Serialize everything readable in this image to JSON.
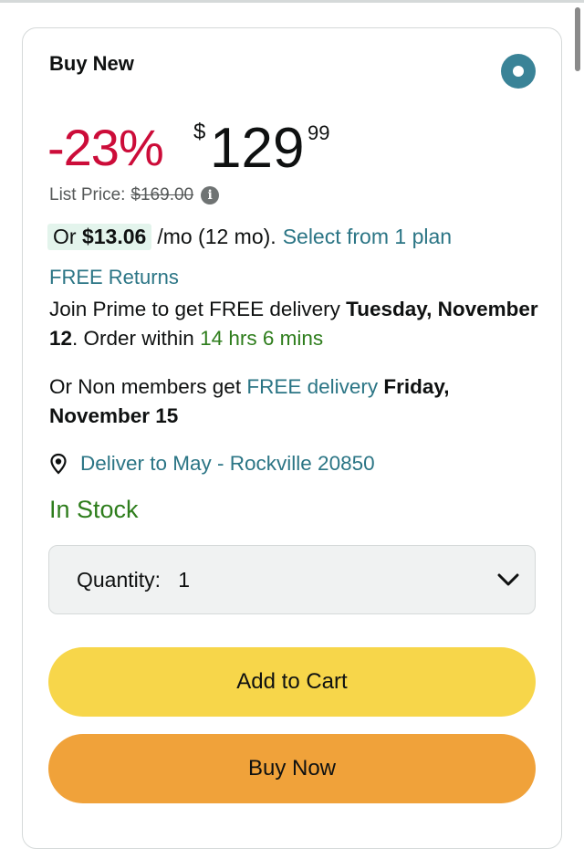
{
  "offer": {
    "title": "Buy New",
    "discount": "-23%",
    "currency": "$",
    "price_whole": "129",
    "price_fraction": "99",
    "list_price_label": "List Price:",
    "list_price": "$169.00",
    "monthly_prefix": "Or",
    "monthly_amount": "$13.06",
    "monthly_term": "/mo (12 mo).",
    "plan_link": "Select from 1 plan"
  },
  "shipping": {
    "free_returns": "FREE Returns",
    "prime_text": "Join Prime to get FREE delivery",
    "prime_date": "Tuesday, November 12",
    "order_within_prefix": ". Order within",
    "countdown": "14 hrs 6 mins",
    "non_member_prefix": "Or Non members get",
    "non_member_link": "FREE delivery",
    "non_member_date": "Friday, November 15",
    "deliver_to": "Deliver to May - Rockville 20850",
    "stock": "In Stock"
  },
  "quantity": {
    "label": "Quantity:",
    "value": "1"
  },
  "buttons": {
    "add_to_cart": "Add to Cart",
    "buy_now": "Buy Now"
  },
  "icons": {
    "radio": "radio-selected-icon",
    "info": "info-icon",
    "location": "location-pin-icon",
    "chevron": "chevron-down-icon"
  },
  "colors": {
    "discount": "#cc0c39",
    "link": "#2b7585",
    "in_stock": "#2e7d1c",
    "add_to_cart": "#f7d64a",
    "buy_now": "#f0a23a",
    "radio": "#3a8397"
  }
}
